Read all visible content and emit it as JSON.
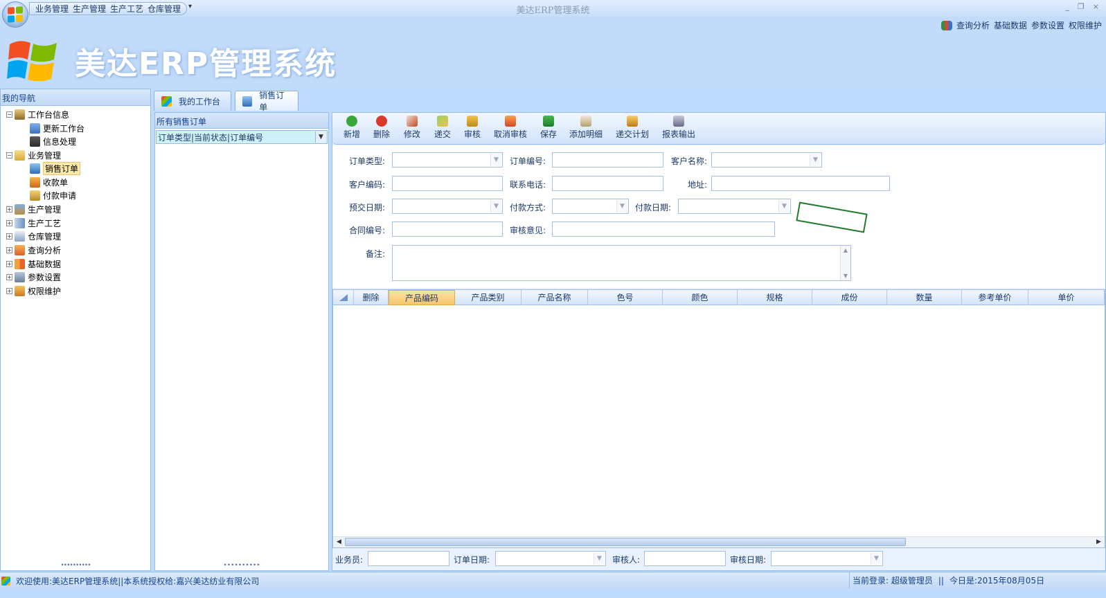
{
  "app": {
    "title": "美达ERP管理系统",
    "banner_title": "美达ERP管理系统"
  },
  "quick_access": [
    "业务管理",
    "生产管理",
    "生产工艺",
    "仓库管理"
  ],
  "window_controls": {
    "minimize": "_",
    "restore": "❐",
    "close": "×"
  },
  "header_links": [
    "查询分析",
    "基础数据",
    "参数设置",
    "权限维护"
  ],
  "nav": {
    "title": "我的导航",
    "items": [
      {
        "label": "工作台信息",
        "level": 0,
        "expander": "−",
        "icon": "desk-icon"
      },
      {
        "label": "更新工作台",
        "level": 1,
        "icon": "refresh-icon"
      },
      {
        "label": "信息处理",
        "level": 1,
        "icon": "phone-icon"
      },
      {
        "label": "业务管理",
        "level": 0,
        "expander": "−",
        "icon": "folder-icon"
      },
      {
        "label": "销售订单",
        "level": 1,
        "icon": "document-icon",
        "selected": true
      },
      {
        "label": "收款单",
        "level": 1,
        "icon": "receipt-icon"
      },
      {
        "label": "付款申请",
        "level": 1,
        "icon": "payment-icon"
      },
      {
        "label": "生产管理",
        "level": 0,
        "expander": "+",
        "icon": "production-icon"
      },
      {
        "label": "生产工艺",
        "level": 0,
        "expander": "+",
        "icon": "process-icon"
      },
      {
        "label": "仓库管理",
        "level": 0,
        "expander": "+",
        "icon": "warehouse-icon"
      },
      {
        "label": "查询分析",
        "level": 0,
        "expander": "+",
        "icon": "analysis-icon"
      },
      {
        "label": "基础数据",
        "level": 0,
        "expander": "+",
        "icon": "grid-icon"
      },
      {
        "label": "参数设置",
        "level": 0,
        "expander": "+",
        "icon": "settings-icon"
      },
      {
        "label": "权限维护",
        "level": 0,
        "expander": "+",
        "icon": "users-icon"
      }
    ]
  },
  "tabs": [
    {
      "label": "我的工作台",
      "active": false
    },
    {
      "label": "销售订单",
      "active": true
    }
  ],
  "list_panel": {
    "title": "所有销售订单",
    "filter_value": "订单类型|当前状态|订单编号"
  },
  "toolbar": [
    "新增",
    "删除",
    "修改",
    "递交",
    "审核",
    "取消审核",
    "保存",
    "添加明细",
    "递交计划",
    "报表输出"
  ],
  "form": {
    "order_type_label": "订单类型:",
    "order_no_label": "订单编号:",
    "customer_name_label": "客户名称:",
    "customer_code_label": "客户编码:",
    "phone_label": "联系电话:",
    "address_label": "地址:",
    "delivery_date_label": "预交日期:",
    "payment_method_label": "付款方式:",
    "payment_date_label": "付款日期:",
    "contract_no_label": "合同编号:",
    "audit_opinion_label": "审核意见:",
    "remark_label": "备注:"
  },
  "grid": {
    "columns": [
      "删除",
      "产品编码",
      "产品类别",
      "产品名称",
      "色号",
      "颜色",
      "规格",
      "成份",
      "数量",
      "参考单价",
      "单价"
    ],
    "highlighted_column": "产品编码",
    "rows": []
  },
  "bottom_fields": {
    "salesman_label": "业务员:",
    "order_date_label": "订单日期:",
    "auditor_label": "审核人:",
    "audit_date_label": "审核日期:"
  },
  "status": {
    "welcome": "欢迎使用:美达ERP管理系统||本系统授权给:嘉兴美达纺业有限公司",
    "login": "当前登录: 超级管理员",
    "separator": "||",
    "date": "今日是:2015年08月05日"
  },
  "colors": {
    "header_bg": "#c3dbfa",
    "panel_border": "#99bbe8",
    "selected_bg": "#fde9a8",
    "stamp": "#1f7a2e"
  }
}
